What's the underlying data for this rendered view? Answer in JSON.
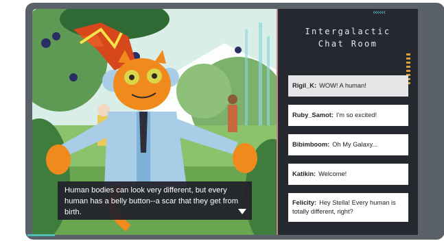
{
  "game": {
    "chat_title_line1": "Intergalactic",
    "chat_title_line2": "Chat Room",
    "dialog_text": "Human bodies can look very different, but every human has a belly button--a scar that they get from birth.",
    "messages": [
      {
        "user": "Rigil_K:",
        "text": "WOW! A human!"
      },
      {
        "user": "Ruby_Samot:",
        "text": "I'm so excited!"
      },
      {
        "user": "Bibimboom:",
        "text": "Oh My Galaxy..."
      },
      {
        "user": "Katikin:",
        "text": "Welcome!"
      },
      {
        "user": "Felicity:",
        "text": "Hey Stella! Every human is totally different, right?"
      }
    ]
  },
  "colors": {
    "frame": "#5a6168",
    "panel": "#262830",
    "panel_border": "#c87f8a",
    "accent_cyan": "#59c7d8",
    "character_orange": "#f08a1c",
    "hat_red": "#d6471b"
  },
  "icons": {
    "dialog_next": "triangle-down-icon",
    "panel_chevrons": "chevrons-left-icon"
  }
}
